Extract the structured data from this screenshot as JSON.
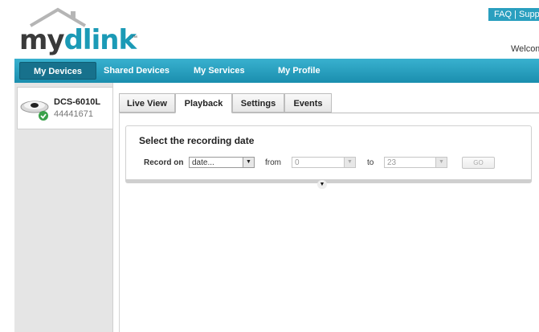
{
  "header": {
    "logo": {
      "part1": "my",
      "part2": "dlink",
      "trademark": "™"
    },
    "help": {
      "faq": "FAQ",
      "separator": " | ",
      "support": "Supp"
    },
    "welcome": "Welcom"
  },
  "nav": {
    "items": [
      {
        "label": "My Devices",
        "active": true
      },
      {
        "label": "Shared Devices"
      },
      {
        "label": "My Services"
      },
      {
        "label": "My Profile"
      }
    ]
  },
  "device": {
    "name": "DCS-6010L",
    "id": "44441671",
    "status": "online-check-icon"
  },
  "tabs": [
    {
      "label": "Live View"
    },
    {
      "label": "Playback",
      "active": true
    },
    {
      "label": "Settings"
    },
    {
      "label": "Events"
    }
  ],
  "playback": {
    "title": "Select the recording date",
    "record_on_label": "Record on",
    "date_value": "date...",
    "from_label": "from",
    "from_value": "0",
    "to_label": "to",
    "to_value": "23",
    "go_label": "GO",
    "dropdown_arrow": "▼",
    "toggle_icon": "▼"
  },
  "colors": {
    "accent": "#1b9ab6",
    "nav_active": "#17718c",
    "status_ok": "#3aa14a"
  }
}
